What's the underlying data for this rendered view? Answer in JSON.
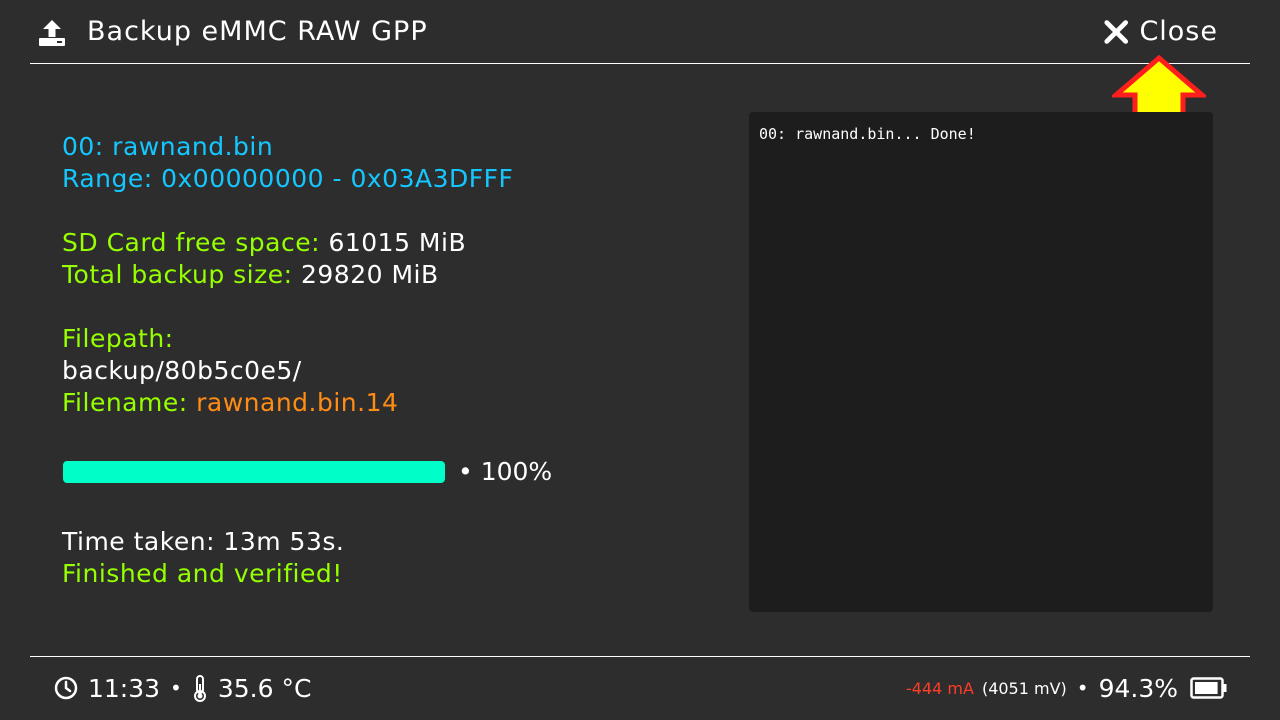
{
  "header": {
    "icon": "upload-icon",
    "title": "Backup eMMC RAW GPP",
    "close_label": "Close",
    "close_icon": "close-icon"
  },
  "info": {
    "part_line": "00: rawnand.bin",
    "range_label": "Range: ",
    "range_value": "0x00000000 - 0x03A3DFFF",
    "free_label": "SD Card free space: ",
    "free_value": "61015 MiB",
    "total_label": "Total backup size: ",
    "total_value": "29820 MiB",
    "filepath_label": "Filepath:",
    "filepath_value": "backup/80b5c0e5/",
    "filename_label": "Filename: ",
    "filename_value": "rawnand.bin.14",
    "time_taken": "Time taken: 13m 53s.",
    "status": "Finished and verified!"
  },
  "progress": {
    "percent": 100,
    "text": "• 100%"
  },
  "log": {
    "lines": [
      "00: rawnand.bin... Done!"
    ]
  },
  "footer": {
    "time": "11:33",
    "separator": "•",
    "temperature": "35.6 °C",
    "current": "-444 mA",
    "voltage": "(4051 mV)",
    "battery_percent": "94.3%",
    "battery_level": 0.943
  },
  "colors": {
    "cyan": "#14c8ff",
    "green": "#96ff00",
    "orange": "#ff8c14",
    "progress": "#00ffc8",
    "current": "#ff3c28",
    "annotation_arrow": "#ffff00"
  }
}
